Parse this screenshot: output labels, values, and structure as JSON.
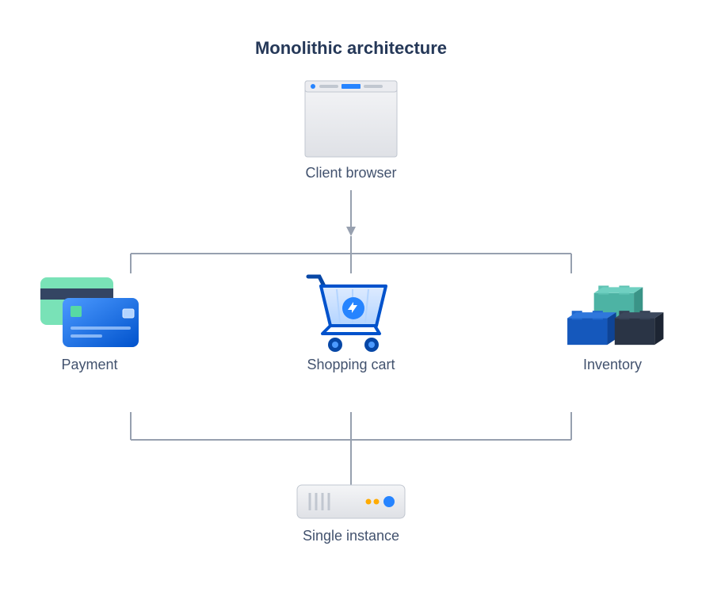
{
  "title": "Monolithic architecture",
  "nodes": {
    "client": "Client browser",
    "payment": "Payment",
    "cart": "Shopping cart",
    "inventory": "Inventory",
    "server": "Single instance"
  },
  "icons": {
    "client": "browser-window-icon",
    "payment": "credit-cards-icon",
    "cart": "shopping-cart-icon",
    "inventory": "blocks-icon",
    "server": "server-icon"
  },
  "colors": {
    "text": "#253858",
    "muted_text": "#42526E",
    "connector": "#97a0af",
    "accent_blue": "#2684FF",
    "accent_teal": "#57D9A3"
  }
}
